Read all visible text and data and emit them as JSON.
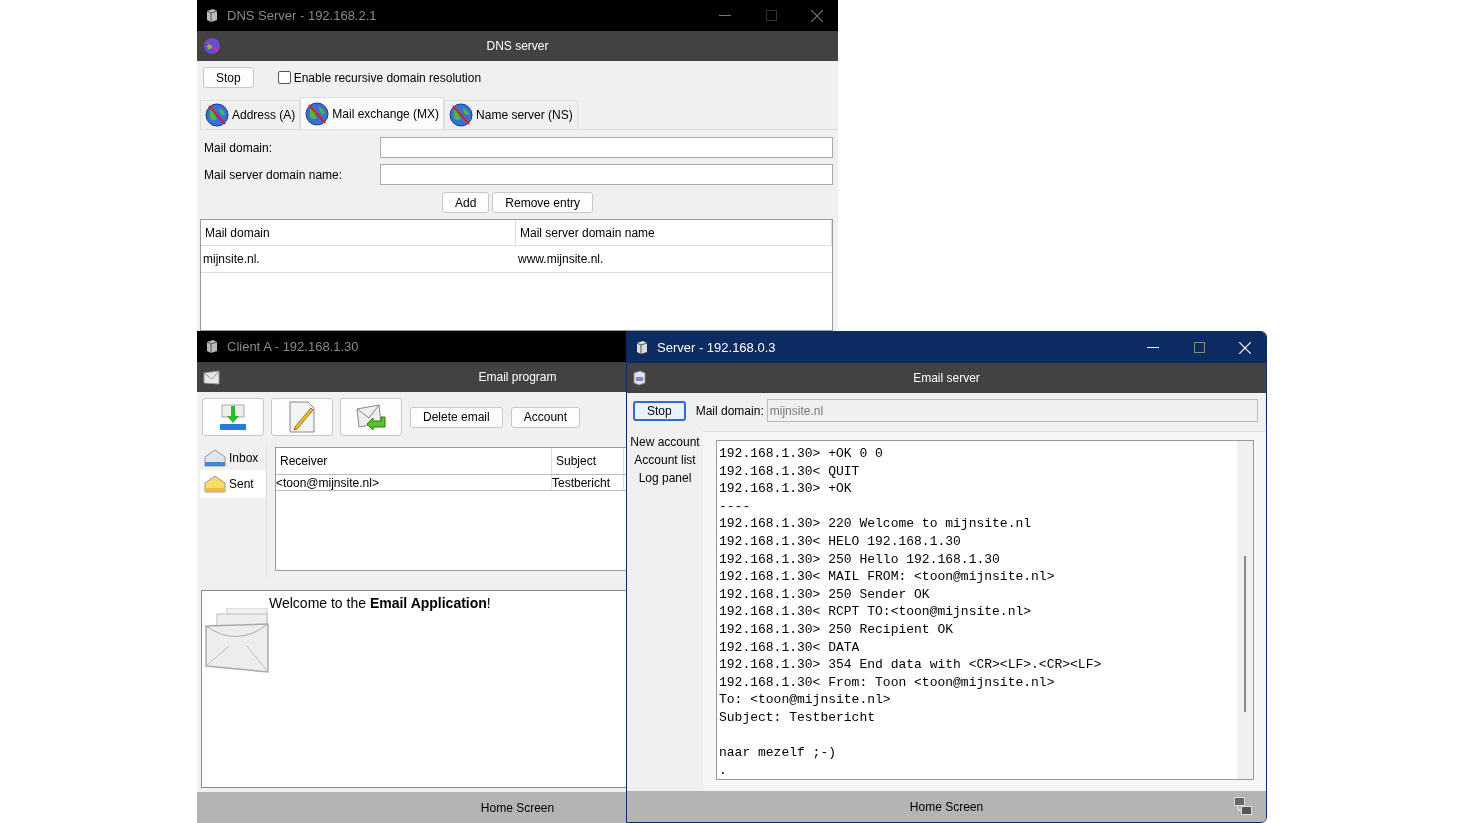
{
  "windows": [
    {
      "kind": "dns",
      "title": "DNS Server - 192.168.2.1",
      "focused": false,
      "header": "DNS server",
      "stop_button": "Stop",
      "recursive_checkbox": {
        "label": "Enable recursive domain resolution",
        "checked": false
      },
      "tabs": [
        {
          "label": "Address (A)",
          "selected": false
        },
        {
          "label": "Mail exchange (MX)",
          "selected": true
        },
        {
          "label": "Name server (NS)",
          "selected": false
        }
      ],
      "fields": [
        {
          "label": "Mail domain:"
        },
        {
          "label": "Mail server domain name:"
        }
      ],
      "buttons": [
        "Add",
        "Remove entry"
      ],
      "table": {
        "columns": [
          "Mail domain",
          "Mail server domain name"
        ],
        "rows": [
          [
            "mijnsite.nl.",
            "www.mijnsite.nl."
          ]
        ]
      }
    },
    {
      "kind": "client",
      "title": "Client A - 192.168.1.30",
      "focused": false,
      "header": "Email program",
      "buttons": [
        "Delete email",
        "Account"
      ],
      "folders": [
        {
          "label": "Inbox",
          "selected": false
        },
        {
          "label": "Sent",
          "selected": true
        }
      ],
      "table": {
        "columns": [
          "Receiver",
          "Subject"
        ],
        "rows": [
          [
            "<toon@mijnsite.nl>",
            "Testbericht"
          ]
        ]
      },
      "welcome": "Welcome to the **Email Application**!",
      "status_bar": "Home Screen"
    },
    {
      "kind": "server",
      "title": "Server - 192.168.0.3",
      "focused": true,
      "header": "Email server",
      "stop_button": "Stop",
      "mail_domain": {
        "label": "Mail domain:",
        "value": "mijnsite.nl",
        "disabled": true
      },
      "side_links": [
        "New account",
        "Account list",
        "Log panel"
      ],
      "log": "192.168.1.30> +OK 0 0\n192.168.1.30< QUIT\n192.168.1.30> +OK\n----\n192.168.1.30> 220 Welcome to mijnsite.nl\n192.168.1.30< HELO 192.168.1.30\n192.168.1.30> 250 Hello 192.168.1.30\n192.168.1.30< MAIL FROM: <toon@mijnsite.nl>\n192.168.1.30> 250 Sender OK\n192.168.1.30< RCPT TO:<toon@mijnsite.nl>\n192.168.1.30> 250 Recipient OK\n192.168.1.30< DATA\n192.168.1.30> 354 End data with <CR><LF>.<CR><LF>\n192.168.1.30< From: Toon <toon@mijnsite.nl>\nTo: <toon@mijnsite.nl>\nSubject: Testbericht\n\nnaar mezelf ;-)\n.",
      "status_bar": "Home Screen"
    }
  ]
}
